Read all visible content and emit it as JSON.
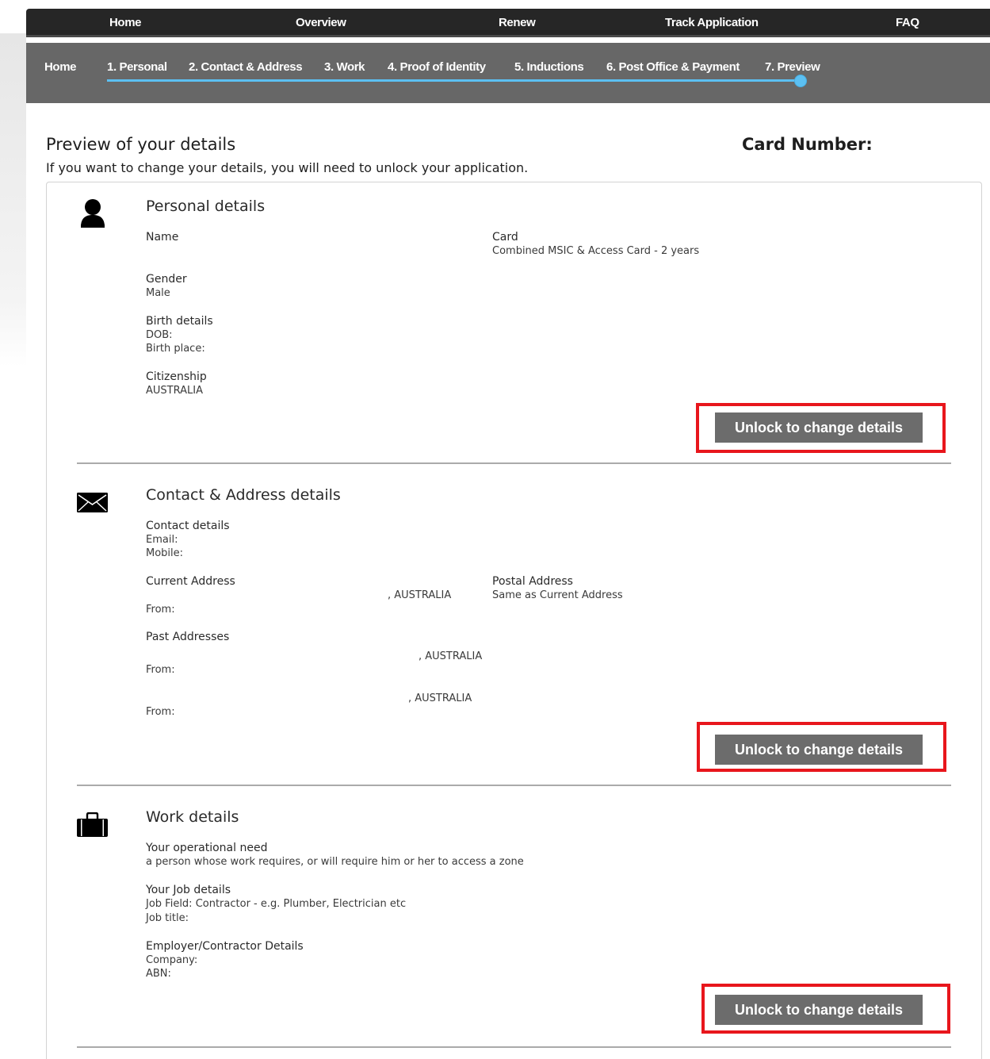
{
  "top_nav": [
    "Home",
    "Overview",
    "Renew",
    "Track Application",
    "FAQ"
  ],
  "steps": [
    "Home",
    "1. Personal",
    "2. Contact & Address",
    "3. Work",
    "4. Proof of Identity",
    "5. Inductions",
    "6. Post Office & Payment",
    "7. Preview"
  ],
  "header": {
    "title": "Preview of your details",
    "card_number_label": "Card Number:",
    "intro": "If you want to change your details, you will need to unlock your application."
  },
  "personal": {
    "title": "Personal details",
    "name_label": "Name",
    "card_label": "Card",
    "card_value": "Combined MSIC & Access Card - 2 years",
    "gender_label": "Gender",
    "gender_value": "Male",
    "birth_label": "Birth details",
    "dob_label": "DOB:",
    "birth_place_label": "Birth place:",
    "citizenship_label": "Citizenship",
    "citizenship_value": "AUSTRALIA",
    "unlock_label": "Unlock to change details"
  },
  "contact": {
    "title": "Contact & Address details",
    "contact_label": "Contact details",
    "email_label": "Email:",
    "mobile_label": "Mobile:",
    "current_label": "Current Address",
    "current_value": ", AUSTRALIA",
    "from_label": "From:",
    "postal_label": "Postal Address",
    "postal_value": "Same as Current Address",
    "past_label": "Past Addresses",
    "past1_value": ", AUSTRALIA",
    "past2_value": ", AUSTRALIA",
    "unlock_label": "Unlock to change details"
  },
  "work": {
    "title": "Work details",
    "need_label": "Your operational need",
    "need_value": "a person whose work requires, or will require him or her to access a zone",
    "job_label": "Your Job details",
    "job_field": "Job Field: Contractor - e.g. Plumber, Electrician etc",
    "job_title_label": "Job title:",
    "employer_label": "Employer/Contractor Details",
    "company_label": "Company:",
    "abn_label": "ABN:",
    "unlock_label": "Unlock to change details"
  },
  "highlight_color": "#e8161c",
  "button_color": "#6c6c6c",
  "accent_color": "#5cc0f2"
}
